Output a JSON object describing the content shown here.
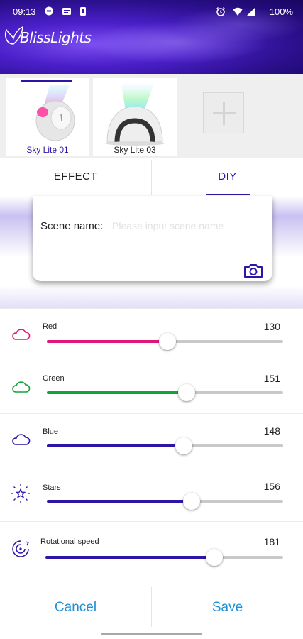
{
  "status_bar": {
    "time": "09:13",
    "battery": "100%"
  },
  "header": {
    "logo_text": "BlissLights"
  },
  "devices": {
    "items": [
      {
        "name": "Sky Lite 01",
        "selected": true
      },
      {
        "name": "Sky Lite 03",
        "selected": false
      }
    ],
    "add_icon": "plus-icon"
  },
  "tabs": [
    {
      "label": "EFFECT",
      "active": false
    },
    {
      "label": "DIY",
      "active": true
    }
  ],
  "scene": {
    "label": "Scene name:",
    "placeholder": "Please input scene name",
    "value": "",
    "camera_icon": "camera-icon"
  },
  "sliders": [
    {
      "label": "Red",
      "value": "130",
      "max": 255,
      "color": "#e0177a",
      "icon": "cloud-icon"
    },
    {
      "label": "Green",
      "value": "151",
      "max": 255,
      "color": "#12a33b",
      "icon": "cloud-icon"
    },
    {
      "label": "Blue",
      "value": "148",
      "max": 255,
      "color": "#2c16a6",
      "icon": "cloud-icon"
    },
    {
      "label": "Stars",
      "value": "156",
      "max": 255,
      "color": "#2c16a6",
      "icon": "star-burst-icon"
    },
    {
      "label": "Rotational speed",
      "value": "181",
      "max": 255,
      "color": "#2c16a6",
      "icon": "rotation-icon"
    }
  ],
  "buttons": {
    "cancel": "Cancel",
    "save": "Save"
  },
  "colors": {
    "accent": "#2c16a6",
    "button_text": "#1f8fd6",
    "banner": "#3a17b8"
  }
}
